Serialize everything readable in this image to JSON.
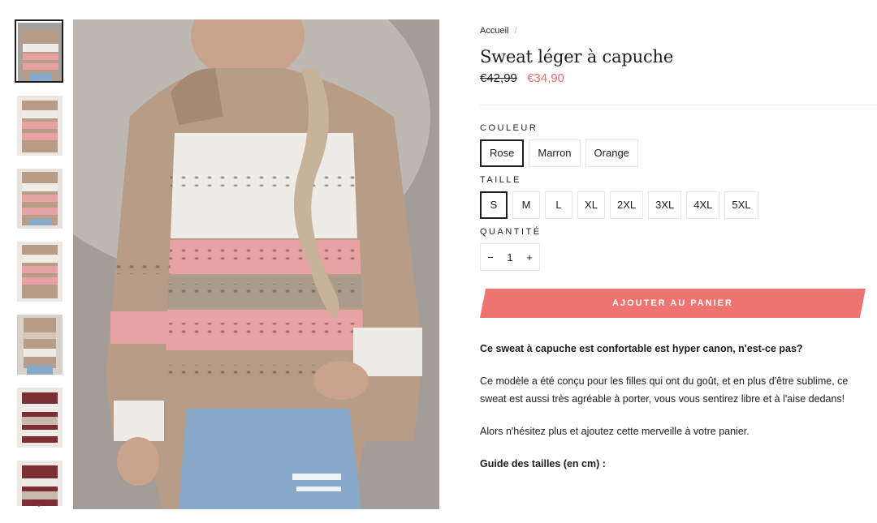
{
  "breadcrumb": {
    "home": "Accueil",
    "separator": "/"
  },
  "product": {
    "title": "Sweat léger à capuche",
    "price_old": "€42,99",
    "price_new": "€34,90"
  },
  "options": {
    "color_label": "COULEUR",
    "colors": [
      "Rose",
      "Marron",
      "Orange"
    ],
    "color_selected": "Rose",
    "size_label": "TAILLE",
    "sizes": [
      "S",
      "M",
      "L",
      "XL",
      "2XL",
      "3XL",
      "4XL",
      "5XL"
    ],
    "size_selected": "S",
    "qty_label": "QUANTITÉ",
    "qty_minus": "−",
    "qty_value": "1",
    "qty_plus": "+"
  },
  "cart_button": "AJOUTER AU PANIER",
  "description": {
    "headline": "Ce sweat à capuche est confortable est hyper canon, n'est-ce pas?",
    "paragraph1": "Ce modèle a été conçu pour les filles qui ont du goût, et en plus d'être sublime, ce sweat est aussi très agréable à porter, vous vous sentirez libre et à l'aise dedans!",
    "paragraph2": "Alors n'hésitez plus et ajoutez cette merveille à votre panier.",
    "size_guide": "Guide des tailles (en cm) :"
  },
  "gallery": {
    "thumb_count": 7,
    "scroll_icon": "chevron-down-icon",
    "scroll_glyph": "⌄",
    "colors": {
      "skin": "#c9a38b",
      "knit_tan": "#b79c87",
      "knit_pink": "#e9a2a4",
      "knit_white": "#efebe6",
      "denim": "#88a9c9",
      "wall": "#a49d97",
      "burgundy": "#7b2f35"
    }
  }
}
